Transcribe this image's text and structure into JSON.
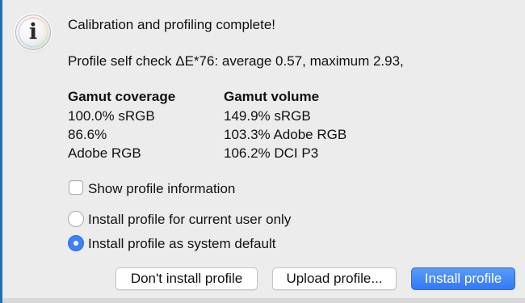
{
  "dialog": {
    "icon": "info-icon",
    "icon_glyph": "i",
    "headline": "Calibration and profiling complete!",
    "self_check": "Profile self check ΔE*76: average 0.57, maximum 2.93,"
  },
  "gamut": {
    "coverage_header": "Gamut coverage",
    "volume_header": "Gamut volume",
    "coverage_values": [
      "100.0% sRGB",
      "86.6%",
      "Adobe RGB"
    ],
    "volume_values": [
      "149.9% sRGB",
      "103.3% Adobe RGB",
      "106.2% DCI P3"
    ]
  },
  "options": {
    "show_info_label": "Show profile information",
    "show_info_checked": false,
    "install_current_user_label": "Install profile for current user only",
    "install_system_default_label": "Install profile as system default",
    "selected_option": "Install profile as system default"
  },
  "buttons": {
    "dont_install": "Don't install profile",
    "upload": "Upload profile...",
    "install": "Install profile"
  },
  "colors": {
    "accent": "#3478f6",
    "background": "#ececec"
  }
}
